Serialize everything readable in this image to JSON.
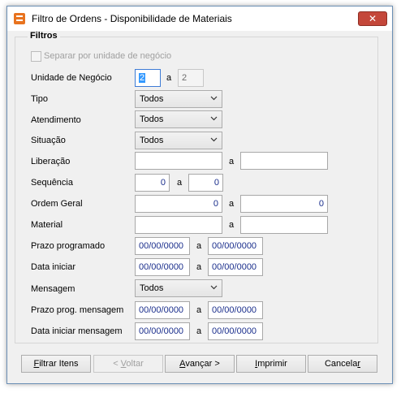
{
  "window": {
    "title": "Filtro de Ordens - Disponibilidade de Materiais"
  },
  "group": {
    "legend": "Filtros"
  },
  "checkbox": {
    "label": "Separar por unidade de negócio",
    "checked": false,
    "enabled": false
  },
  "separator": "a",
  "rows": {
    "unidade": {
      "label": "Unidade de Negócio",
      "from": "2",
      "to": "2"
    },
    "tipo": {
      "label": "Tipo",
      "value": "Todos"
    },
    "atendimento": {
      "label": "Atendimento",
      "value": "Todos"
    },
    "situacao": {
      "label": "Situação",
      "value": "Todos"
    },
    "liberacao": {
      "label": "Liberação",
      "from": "",
      "to": ""
    },
    "sequencia": {
      "label": "Sequência",
      "from": "0",
      "to": "0"
    },
    "ordem_geral": {
      "label": "Ordem Geral",
      "from": "0",
      "to": "0"
    },
    "material": {
      "label": "Material",
      "from": "",
      "to": ""
    },
    "prazo_programado": {
      "label": "Prazo programado",
      "from": "00/00/0000",
      "to": "00/00/0000"
    },
    "data_iniciar": {
      "label": "Data iniciar",
      "from": "00/00/0000",
      "to": "00/00/0000"
    },
    "mensagem": {
      "label": "Mensagem",
      "value": "Todos"
    },
    "prazo_prog_mensagem": {
      "label": "Prazo prog. mensagem",
      "from": "00/00/0000",
      "to": "00/00/0000"
    },
    "data_iniciar_mensagem": {
      "label": "Data iniciar mensagem",
      "from": "00/00/0000",
      "to": "00/00/0000"
    }
  },
  "buttons": {
    "filtrar": {
      "pre": "",
      "key": "F",
      "post": "iltrar Itens"
    },
    "voltar": {
      "pre": "< ",
      "key": "V",
      "post": "oltar"
    },
    "avancar": {
      "pre": "",
      "key": "A",
      "post": "vançar >"
    },
    "imprimir": {
      "pre": "",
      "key": "I",
      "post": "mprimir"
    },
    "cancelar": {
      "pre": "Cancela",
      "key": "r",
      "post": ""
    }
  },
  "icons": {
    "close": "close-icon",
    "app": "app-icon",
    "dropdown": "chevron-down-icon"
  },
  "colors": {
    "field_text": "#1a2e8c",
    "close_button": "#c4473a",
    "app_icon": "#e8731f"
  }
}
